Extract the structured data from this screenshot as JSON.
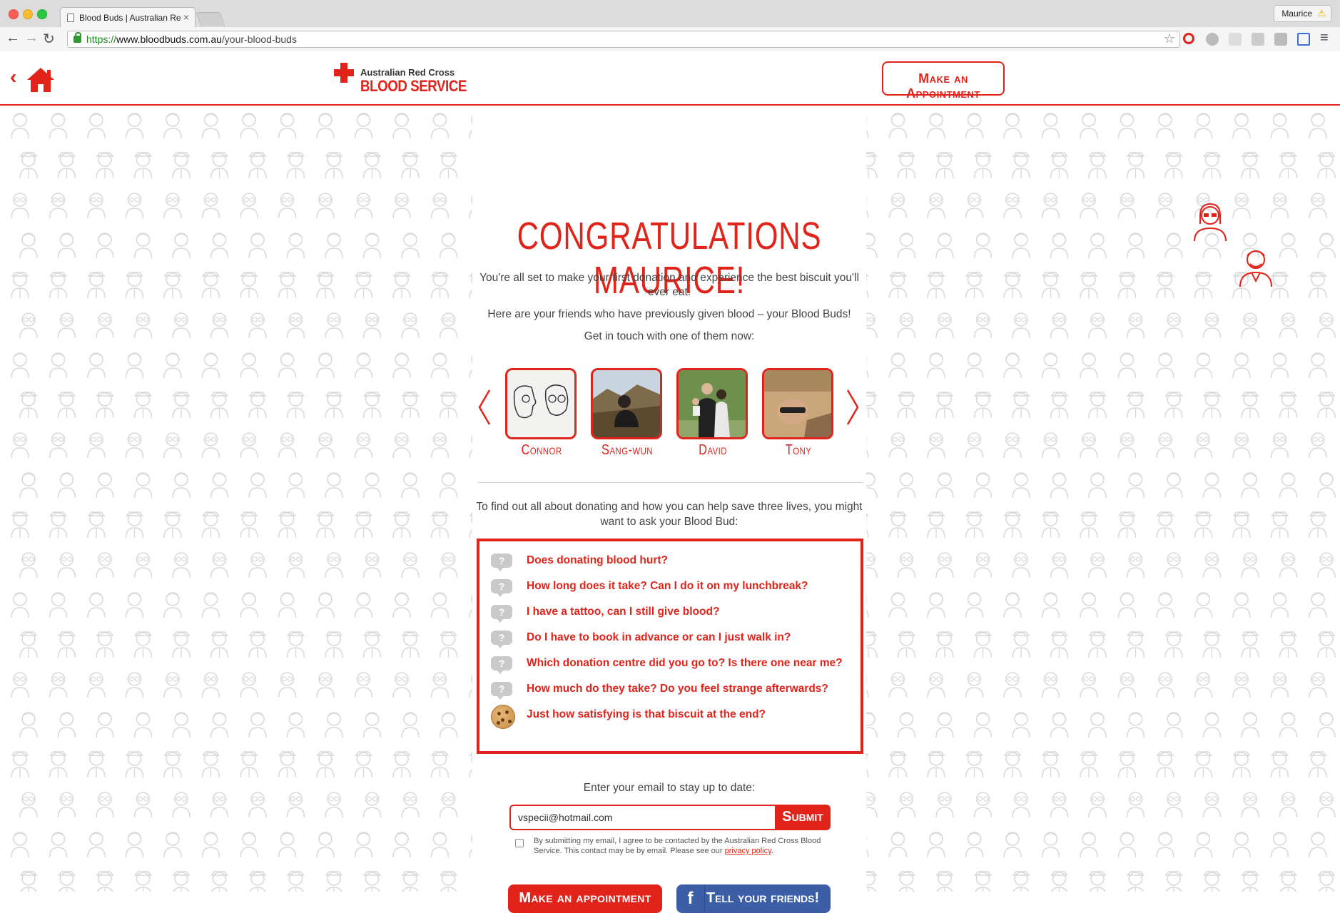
{
  "browser": {
    "tab_title": "Blood Buds | Australian Re",
    "profile_name": "Maurice",
    "url_scheme": "https://",
    "url_domain": "www.bloodbuds.com.au",
    "url_path": "/your-blood-buds"
  },
  "header": {
    "logo_org": "Australian Red Cross",
    "logo_service": "BLOOD SERVICE",
    "appointment_label": "Make an Appointment"
  },
  "main": {
    "title": "CONGRATULATIONS MAURICE!",
    "intro": "You're all set to make your first donation and experience the best biscuit you'll ever eat.",
    "friends_line": "Here are your friends who have previously given blood – your Blood Buds!",
    "cta_line": "Get in touch with one of them now:",
    "buds": [
      {
        "name": "Connor"
      },
      {
        "name": "Sang-wun"
      },
      {
        "name": "David"
      },
      {
        "name": "Tony"
      }
    ],
    "ask_line": "To find out all about donating and how you can help save three lives, you might want to ask your Blood Bud:",
    "questions": [
      "Does donating blood hurt?",
      "How long does it take? Can I do it on my lunchbreak?",
      "I have a tattoo, can I still give blood?",
      "Do I have to book in advance or can I just walk in?",
      "Which donation centre did you go to? Is there one near me?",
      "How much do they take? Do you feel strange afterwards?",
      "Just how satisfying is that biscuit at the end?"
    ],
    "question_icon_text": "?",
    "email_label": "Enter your email to stay up to date:",
    "email_value": "vspecii@hotmail.com",
    "submit_label": "Submit",
    "consent_text": "By submitting my email, I agree to be contacted by the Australian Red Cross Blood Service. This contact may be by email. Please see our",
    "consent_link": "privacy policy",
    "consent_end": ".",
    "appointment_button": "Make an appointment",
    "share_button": "Tell your friends!",
    "facebook_glyph": "f"
  },
  "colors": {
    "accent": "#e2231a",
    "facebook": "#3b5ea6"
  }
}
